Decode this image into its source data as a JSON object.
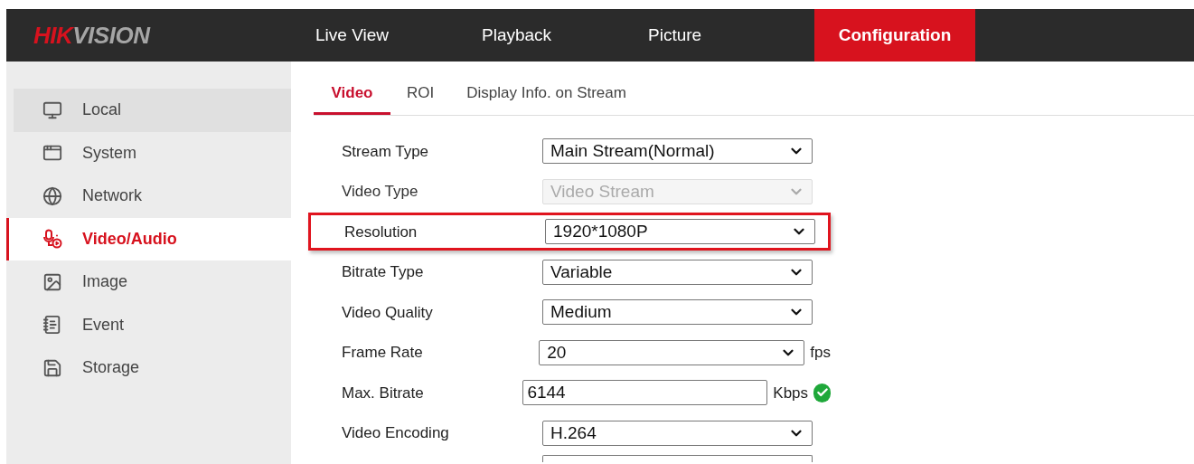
{
  "header": {
    "logo": {
      "brand_part": "HIK",
      "rest_part": "VISION"
    },
    "nav": [
      {
        "label": "Live View",
        "selected": false
      },
      {
        "label": "Playback",
        "selected": false
      },
      {
        "label": "Picture",
        "selected": false
      },
      {
        "label": "Configuration",
        "selected": true
      }
    ]
  },
  "sidebar": {
    "items": [
      {
        "label": "Local",
        "selected": false,
        "hovered": true
      },
      {
        "label": "System",
        "selected": false,
        "hovered": false
      },
      {
        "label": "Network",
        "selected": false,
        "hovered": false
      },
      {
        "label": "Video/Audio",
        "selected": true,
        "hovered": false
      },
      {
        "label": "Image",
        "selected": false,
        "hovered": false
      },
      {
        "label": "Event",
        "selected": false,
        "hovered": false
      },
      {
        "label": "Storage",
        "selected": false,
        "hovered": false
      }
    ]
  },
  "tabs": [
    {
      "label": "Video",
      "selected": true
    },
    {
      "label": "ROI",
      "selected": false
    },
    {
      "label": "Display Info. on Stream",
      "selected": false
    }
  ],
  "form": {
    "rows": [
      {
        "label": "Stream Type",
        "kind": "select",
        "value": "Main Stream(Normal)",
        "disabled": false,
        "highlighted": false
      },
      {
        "label": "Video Type",
        "kind": "select",
        "value": "Video Stream",
        "disabled": true,
        "highlighted": false
      },
      {
        "label": "Resolution",
        "kind": "select",
        "value": "1920*1080P",
        "disabled": false,
        "highlighted": true
      },
      {
        "label": "Bitrate Type",
        "kind": "select",
        "value": "Variable",
        "disabled": false,
        "highlighted": false
      },
      {
        "label": "Video Quality",
        "kind": "select",
        "value": "Medium",
        "disabled": false,
        "highlighted": false
      },
      {
        "label": "Frame Rate",
        "kind": "select",
        "value": "20",
        "disabled": false,
        "highlighted": false,
        "unit": "fps"
      },
      {
        "label": "Max. Bitrate",
        "kind": "input",
        "value": "6144",
        "disabled": false,
        "highlighted": false,
        "unit": "Kbps",
        "valid": true
      },
      {
        "label": "Video Encoding",
        "kind": "select",
        "value": "H.264",
        "disabled": false,
        "highlighted": false
      }
    ]
  }
}
